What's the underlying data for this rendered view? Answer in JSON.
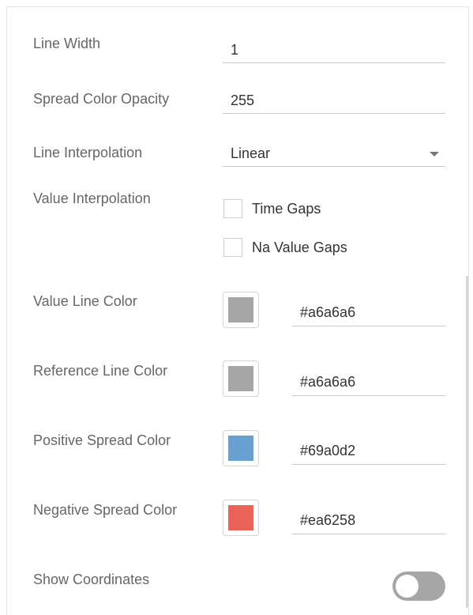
{
  "fields": {
    "line_width": {
      "label": "Line Width",
      "value": "1"
    },
    "spread_color_opacity": {
      "label": "Spread Color Opacity",
      "value": "255"
    },
    "line_interpolation": {
      "label": "Line Interpolation",
      "value": "Linear"
    },
    "value_interpolation": {
      "label": "Value Interpolation",
      "options": [
        {
          "label": "Time Gaps",
          "checked": false
        },
        {
          "label": "Na Value Gaps",
          "checked": false
        }
      ]
    },
    "value_line_color": {
      "label": "Value Line Color",
      "hex": "#a6a6a6",
      "swatch": "#a6a6a6"
    },
    "reference_line_color": {
      "label": "Reference Line Color",
      "hex": "#a6a6a6",
      "swatch": "#a6a6a6"
    },
    "positive_spread_color": {
      "label": "Positive Spread Color",
      "hex": "#69a0d2",
      "swatch": "#69a0d2"
    },
    "negative_spread_color": {
      "label": "Negative Spread Color",
      "hex": "#ea6258",
      "swatch": "#ea6258"
    },
    "show_coordinates": {
      "label": "Show Coordinates",
      "enabled": false
    }
  }
}
